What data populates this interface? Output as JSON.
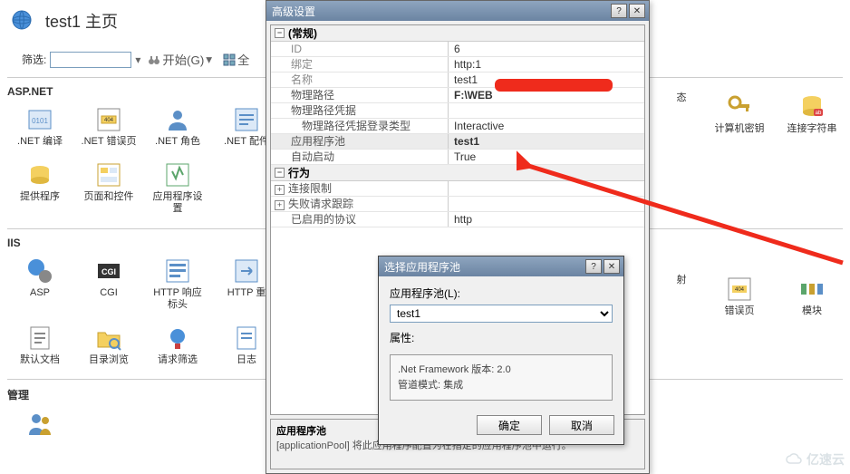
{
  "page": {
    "title": "test1 主页",
    "filter_label": "筛选:",
    "start_label": "开始(G)",
    "showall_label": "全"
  },
  "sections": {
    "aspnet": "ASP.NET",
    "iis": "IIS",
    "mgmt": "管理"
  },
  "icons": {
    "net_compile": ".NET 编译",
    "net_error": ".NET 错误页",
    "net_role": ".NET 角色",
    "net_config": ".NET 配件",
    "providers": "提供程序",
    "pages_controls": "页面和控件",
    "app_settings": "应用程序设置",
    "asp": "ASP",
    "cgi": "CGI",
    "http_resp": "HTTP 响应标头",
    "http_redir": "HTTP 重",
    "default_doc": "默认文档",
    "dir_browse": "目录浏览",
    "request_filter": "请求筛选",
    "logging": "日志",
    "state": "态",
    "machine_key": "计算机密钥",
    "conn_string": "连接字符串",
    "compress": "射",
    "error_pages": "错误页",
    "modules": "模块"
  },
  "adv_dialog": {
    "title": "高级设置",
    "cat_general": "(常规)",
    "cat_behavior": "行为",
    "rows": {
      "id_k": "ID",
      "id_v": "6",
      "bind_k": "绑定",
      "bind_v": "http:1",
      "name_k": "名称",
      "name_v": "test1",
      "path_k": "物理路径",
      "path_v": "F:\\WEB",
      "cred_k": "物理路径凭据",
      "cred_v": "",
      "logon_k": "物理路径凭据登录类型",
      "logon_v": "Interactive",
      "pool_k": "应用程序池",
      "pool_v": "test1",
      "auto_k": "自动启动",
      "auto_v": "True",
      "conn_k": "连接限制",
      "fail_k": "失败请求跟踪",
      "proto_k": "已启用的协议",
      "proto_v": "http"
    },
    "desc_title": "应用程序池",
    "desc_text": "[applicationPool] 将此应用程序配置为在指定的应用程序池中运行。"
  },
  "pool_dialog": {
    "title": "选择应用程序池",
    "label": "应用程序池(L):",
    "value": "test1",
    "props_label": "属性:",
    "fw_line": ".Net Framework 版本: 2.0",
    "mode_line": "管道模式: 集成",
    "ok": "确定",
    "cancel": "取消"
  },
  "watermark": "亿速云"
}
